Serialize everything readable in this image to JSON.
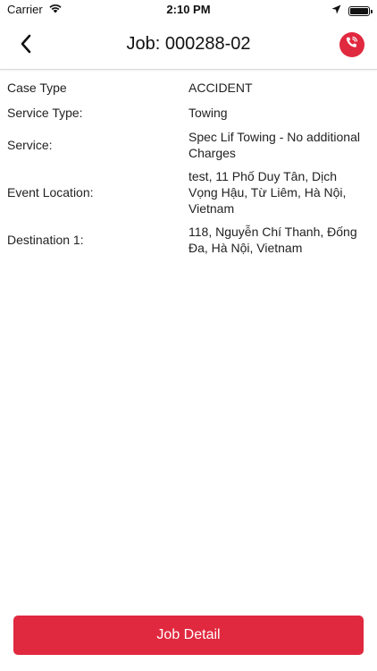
{
  "status_bar": {
    "carrier": "Carrier",
    "time": "2:10 PM",
    "icons": [
      "wifi-icon",
      "location-arrow-icon",
      "battery-icon"
    ]
  },
  "nav": {
    "back_icon": "chevron-left-icon",
    "title": "Job:  000288-02",
    "call_icon": "phone-call-icon"
  },
  "details": [
    {
      "label": "Case Type",
      "value": "ACCIDENT"
    },
    {
      "label": "Service Type:",
      "value": "Towing"
    },
    {
      "label": "Service:",
      "value": "Spec Lif Towing - No additional Charges"
    },
    {
      "label": "Event Location:",
      "value": "test, 11 Phố Duy Tân, Dịch Vọng Hậu, Từ Liêm, Hà Nội, Vietnam"
    },
    {
      "label": "Destination 1:",
      "value": "118, Nguyễn Chí Thanh, Đống Đa, Hà Nội, Vietnam"
    }
  ],
  "footer": {
    "job_detail_label": "Job Detail"
  },
  "colors": {
    "accent": "#e0293f",
    "text": "#222222"
  }
}
